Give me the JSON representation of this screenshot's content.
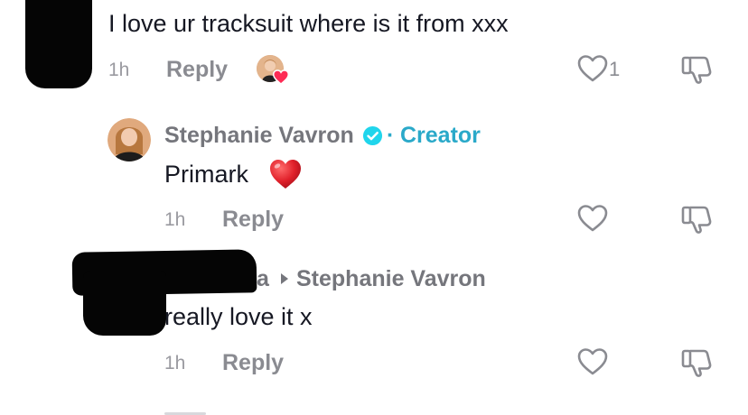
{
  "comment1": {
    "text": "I love ur tracksuit where is it from xxx",
    "time": "1h",
    "reply_label": "Reply",
    "like_count": "1"
  },
  "reply1": {
    "username": "Stephanie Vavron",
    "separator": "·",
    "creator_label": "Creator",
    "text": "Primark",
    "emoji": "heart",
    "time": "1h",
    "reply_label": "Reply"
  },
  "reply2": {
    "username_suffix": "a",
    "reply_to": "Stephanie Vavron",
    "text": "really love it x",
    "time": "1h",
    "reply_label": "Reply"
  },
  "colors": {
    "creator_accent": "#2aa9c9",
    "verified_badge": "#20d5ec",
    "heart_emoji": "#e0202a",
    "liked_heart_badge": "#fe2c55"
  },
  "icons": [
    "heart-outline-icon",
    "dislike-icon",
    "verified-badge-icon",
    "reply-arrow-icon",
    "heart-emoji-icon"
  ]
}
